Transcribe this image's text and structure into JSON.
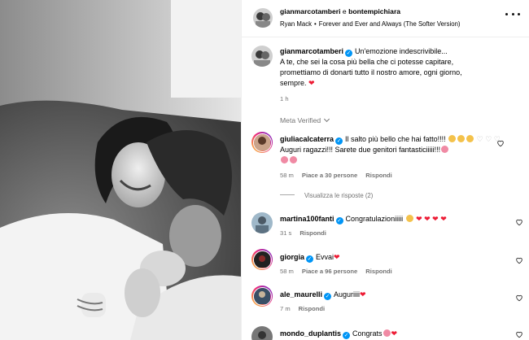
{
  "header": {
    "user1": "gianmarcotamberi",
    "conj": " e ",
    "user2": "bontempichiara",
    "music_artist": "Ryan Mack",
    "music_sep": "•",
    "music_title": "Forever and Ever and Always (The Softer Version)"
  },
  "caption": {
    "username": "gianmarcotamberi",
    "line1": "Un'emozione indescrivibile...",
    "line2": "A te, che sei la cosa più bella che ci potesse capitare,",
    "line3": "promettiamo di donarti tutto il nostro amore, ogni giorno,",
    "line4": "sempre. ",
    "heart": "❤",
    "time": "1 h"
  },
  "meta_verified": "Meta Verified",
  "comments": [
    {
      "username": "giuliacalcaterra",
      "text_a": "Il salto più bello che hai fatto!!!! ",
      "text_b": " Auguri ragazzi!!! Sarete due genitori fantasticiiiii!!!",
      "time": "58 m",
      "likes": "Piace a 30 persone",
      "reply": "Rispondi",
      "view_replies": "Visualizza le risposte (2)"
    },
    {
      "username": "martina100fanti",
      "text": "Congratulazioniiiii ",
      "hearts": "❤ ❤ ❤ ❤",
      "time": "31 s",
      "reply": "Rispondi"
    },
    {
      "username": "giorgia",
      "text": "Evvai",
      "heart": "❤",
      "time": "58 m",
      "likes": "Piace a 96 persone",
      "reply": "Rispondi"
    },
    {
      "username": "ale_maurelli",
      "text": "Auguriiii",
      "heart": "❤",
      "time": "7 m",
      "reply": "Rispondi"
    },
    {
      "username": "mondo_duplantis",
      "text": "Congrats",
      "heart": "❤"
    }
  ],
  "colors": {
    "accent": "#0095f6",
    "heart": "#ed1b34",
    "muted": "#737373"
  },
  "icons": [
    "more-icon",
    "verified-icon",
    "heart-outline-icon",
    "chevron-down-icon"
  ]
}
